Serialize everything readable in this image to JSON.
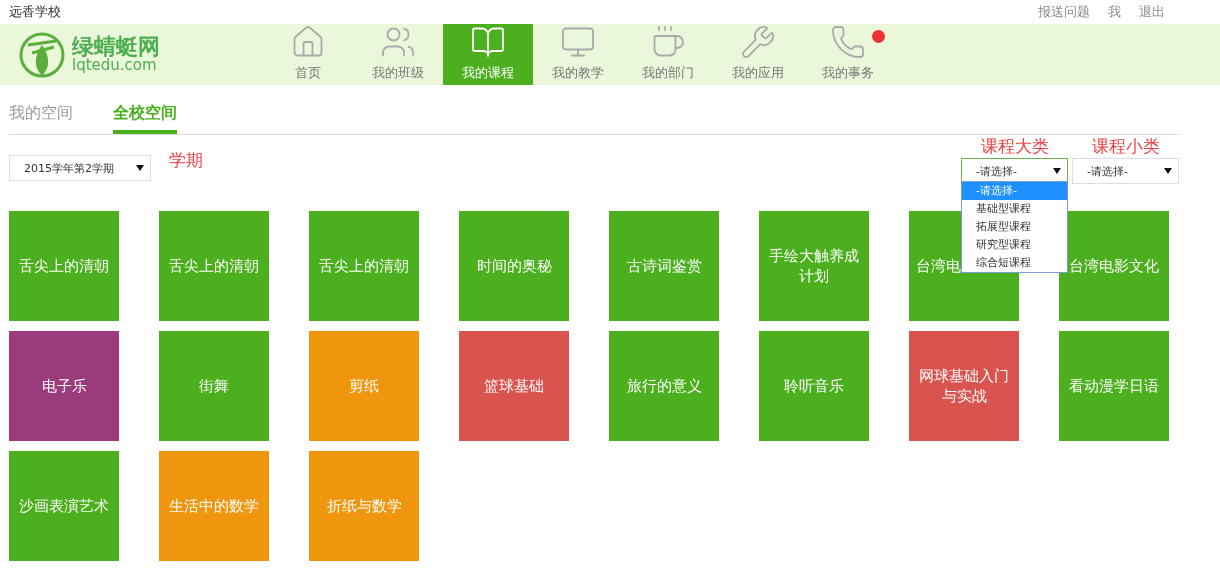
{
  "school": "远香学校",
  "top_links": [
    "报送问题",
    "我",
    "退出"
  ],
  "logo": {
    "name": "绿蜻蜓网",
    "domain": "lqtedu.com"
  },
  "nav": [
    {
      "kind": "home",
      "label": "首页",
      "selected": false,
      "badge": false
    },
    {
      "kind": "users",
      "label": "我的班级",
      "selected": false,
      "badge": false
    },
    {
      "kind": "book",
      "label": "我的课程",
      "selected": true,
      "badge": false
    },
    {
      "kind": "monitor",
      "label": "我的教学",
      "selected": false,
      "badge": false
    },
    {
      "kind": "cup",
      "label": "我的部门",
      "selected": false,
      "badge": false
    },
    {
      "kind": "wrench",
      "label": "我的应用",
      "selected": false,
      "badge": false
    },
    {
      "kind": "phone",
      "label": "我的事务",
      "selected": false,
      "badge": true
    }
  ],
  "tabs": [
    {
      "label": "我的空间",
      "selected": false
    },
    {
      "label": "全校空间",
      "selected": true
    }
  ],
  "term": {
    "value": "2015学年第2学期",
    "label": "学期"
  },
  "category": {
    "label": "课程大类",
    "value": "-请选择-",
    "options": [
      {
        "label": "-请选择-",
        "selected": true
      },
      {
        "label": "基础型课程",
        "selected": false
      },
      {
        "label": "拓展型课程",
        "selected": false
      },
      {
        "label": "研究型课程",
        "selected": false
      },
      {
        "label": "综合短课程",
        "selected": false
      }
    ]
  },
  "subcategory": {
    "label": "课程小类",
    "value": "-请选择-"
  },
  "courses": [
    {
      "title": "舌尖上的清朝",
      "color": "#4cb01e"
    },
    {
      "title": "舌尖上的清朝",
      "color": "#4cb01e"
    },
    {
      "title": "舌尖上的清朝",
      "color": "#4cb01e"
    },
    {
      "title": "时间的奥秘",
      "color": "#4cb01e"
    },
    {
      "title": "古诗词鉴赏",
      "color": "#4cb01e"
    },
    {
      "title": "手绘大触养成计划",
      "color": "#4cb01e"
    },
    {
      "title": "台湾电",
      "color": "#4cb01e",
      "covered": true
    },
    {
      "title": "台湾电影文化",
      "color": "#4cb01e"
    },
    {
      "title": "电子乐",
      "color": "#9b3b7b"
    },
    {
      "title": "街舞",
      "color": "#4cb01e"
    },
    {
      "title": "剪纸",
      "color": "#f0960e"
    },
    {
      "title": "篮球基础",
      "color": "#d9534f"
    },
    {
      "title": "旅行的意义",
      "color": "#4cb01e"
    },
    {
      "title": "聆听音乐",
      "color": "#4cb01e"
    },
    {
      "title": "网球基础入门与实战",
      "color": "#d9534f"
    },
    {
      "title": "看动漫学日语",
      "color": "#4cb01e"
    },
    {
      "title": "沙画表演艺术",
      "color": "#4cb01e"
    },
    {
      "title": "生活中的数学",
      "color": "#f0960e"
    },
    {
      "title": "折纸与数学",
      "color": "#f0960e"
    }
  ]
}
